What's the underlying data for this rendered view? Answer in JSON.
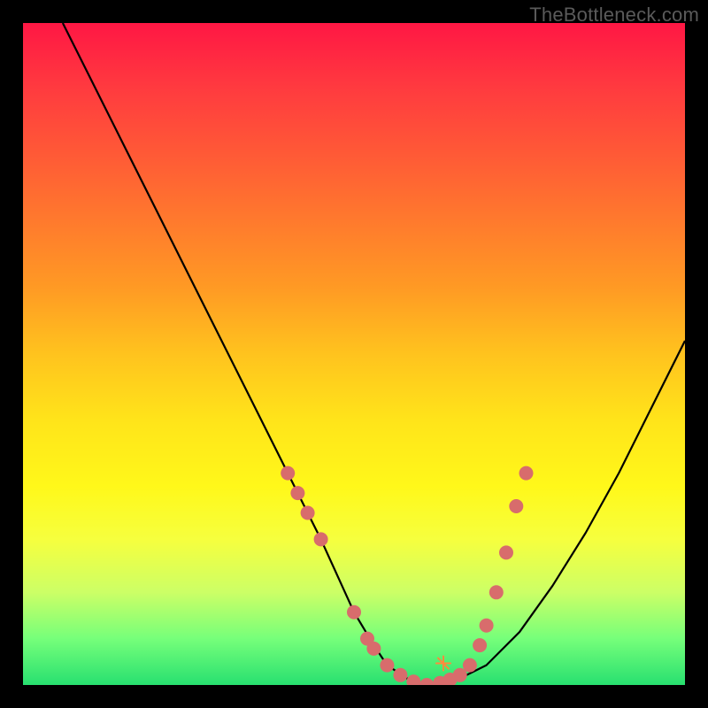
{
  "branding": "TheBottleneck.com",
  "chart_data": {
    "type": "line",
    "title": "",
    "xlabel": "",
    "ylabel": "",
    "xlim": [
      0,
      100
    ],
    "ylim": [
      0,
      100
    ],
    "series": [
      {
        "name": "curve",
        "x": [
          6,
          10,
          15,
          20,
          25,
          30,
          35,
          40,
          45,
          50,
          53,
          55,
          58,
          60,
          63,
          66,
          70,
          75,
          80,
          85,
          90,
          95,
          100
        ],
        "values": [
          100,
          92,
          82,
          72,
          62,
          52,
          42,
          32,
          22,
          11,
          6,
          3,
          1,
          0,
          0,
          1,
          3,
          8,
          15,
          23,
          32,
          42,
          52
        ]
      }
    ],
    "markers": [
      {
        "x": 40,
        "y": 32
      },
      {
        "x": 41.5,
        "y": 29
      },
      {
        "x": 43,
        "y": 26
      },
      {
        "x": 45,
        "y": 22
      },
      {
        "x": 50,
        "y": 11
      },
      {
        "x": 52,
        "y": 7
      },
      {
        "x": 53,
        "y": 5.5
      },
      {
        "x": 55,
        "y": 3
      },
      {
        "x": 57,
        "y": 1.5
      },
      {
        "x": 59,
        "y": 0.5
      },
      {
        "x": 61,
        "y": 0
      },
      {
        "x": 63,
        "y": 0.3
      },
      {
        "x": 64.5,
        "y": 0.8
      },
      {
        "x": 66,
        "y": 1.5
      },
      {
        "x": 67.5,
        "y": 3
      },
      {
        "x": 69,
        "y": 6
      },
      {
        "x": 70,
        "y": 9
      },
      {
        "x": 71.5,
        "y": 14
      },
      {
        "x": 73,
        "y": 20
      },
      {
        "x": 74.5,
        "y": 27
      },
      {
        "x": 76,
        "y": 32
      }
    ],
    "colors": {
      "curve": "#000000",
      "markers": "#d86c6c",
      "spark": "#ff8a3d"
    }
  }
}
